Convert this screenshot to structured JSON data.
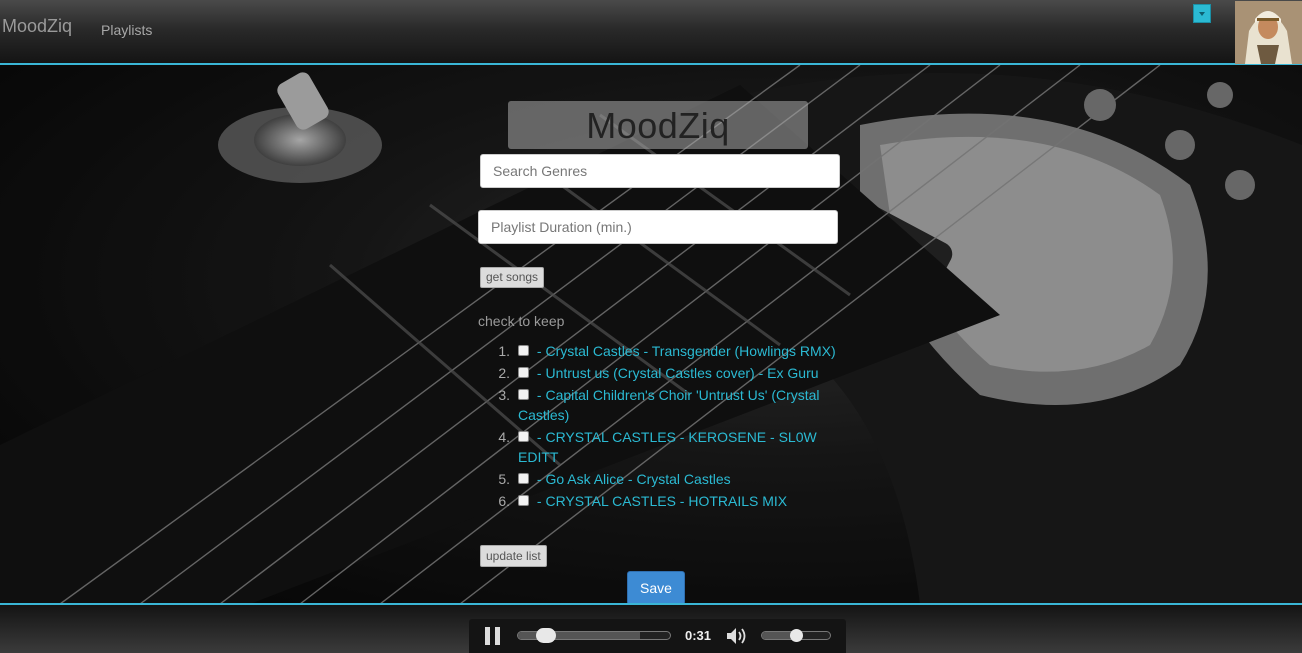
{
  "navbar": {
    "brand": "MoodZiq",
    "playlists_link": "Playlists",
    "accent_color": "#3ab6d6"
  },
  "main": {
    "logo_text": "MoodZiq",
    "search_genres": {
      "placeholder": "Search Genres",
      "value": ""
    },
    "duration": {
      "placeholder": "Playlist Duration (min.)",
      "value": ""
    },
    "get_songs_label": "get songs",
    "check_to_keep_label": "check to keep",
    "songs": [
      {
        "num": "1.",
        "title": "Crystal Castles - Transgender (Howlings RMX)",
        "checked": false
      },
      {
        "num": "2.",
        "title": "Untrust us (Crystal Castles cover) - Ex Guru",
        "checked": false
      },
      {
        "num": "3.",
        "title": "Capital Children's Choir 'Untrust Us' (Crystal Castles)",
        "checked": false
      },
      {
        "num": "4.",
        "title": "CRYSTAL CASTLES - KEROSENE - SL0W EDITT",
        "checked": false
      },
      {
        "num": "5.",
        "title": "Go Ask Alice - Crystal Castles",
        "checked": false
      },
      {
        "num": "6.",
        "title": "CRYSTAL CASTLES - HOTRAILS MIX",
        "checked": false
      }
    ],
    "update_list_label": "update list",
    "save_label": "Save",
    "song_separator": " - "
  },
  "player": {
    "state": "playing",
    "time": "0:31",
    "progress": 0.19,
    "buffered": 0.8,
    "volume": 0.5,
    "icons": {
      "pause": "pause-icon",
      "volume": "volume-icon"
    }
  }
}
